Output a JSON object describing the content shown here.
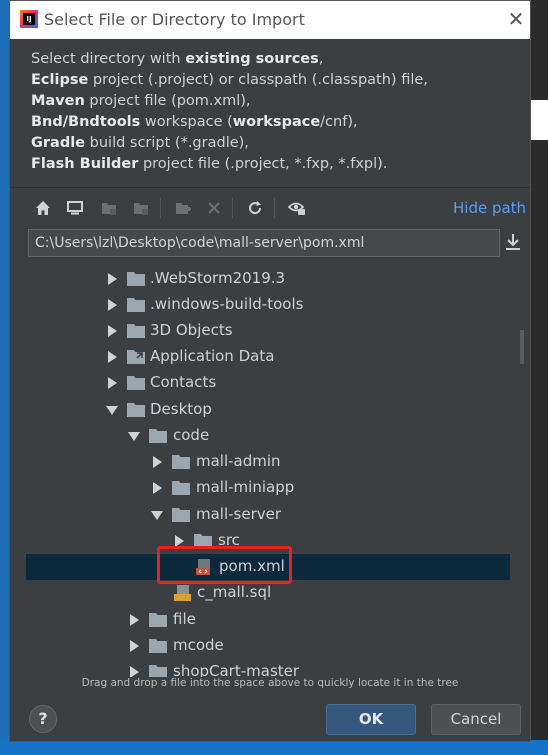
{
  "window": {
    "title": "Select File or Directory to Import",
    "close_glyph": "✕"
  },
  "description": {
    "lines": [
      {
        "pre": "Select directory with ",
        "bold": "existing sources",
        "post": ","
      },
      {
        "pre": "",
        "bold": "Eclipse",
        "post": " project (.project) or classpath (.classpath) file,"
      },
      {
        "pre": "",
        "bold": "Maven",
        "post": " project file (pom.xml),"
      },
      {
        "pre": "",
        "bold": "Bnd/Bndtools",
        "post": " workspace (",
        "bold2": "workspace",
        "post2": "/cnf),"
      },
      {
        "pre": "",
        "bold": "Gradle",
        "post": " build script (*.gradle),"
      },
      {
        "pre": "",
        "bold": "Flash Builder",
        "post": " project file (.project, *.fxp, *.fxpl)."
      }
    ]
  },
  "toolbar": {
    "icons": [
      "home-icon",
      "desktop-icon",
      "project-folder-icon",
      "module-folder-icon",
      "new-folder-icon",
      "delete-icon",
      "refresh-icon",
      "show-hidden-icon"
    ],
    "hide_path_label": "Hide path"
  },
  "path": {
    "value": "C:\\Users\\lzl\\Desktop\\code\\mall-server\\pom.xml"
  },
  "tree": {
    "items": [
      {
        "label": ".WebStorm2019.3",
        "state": "collapsed",
        "type": "folder"
      },
      {
        "label": ".windows-build-tools",
        "state": "collapsed",
        "type": "folder"
      },
      {
        "label": "3D Objects",
        "state": "collapsed",
        "type": "folder"
      },
      {
        "label": "Application Data",
        "state": "collapsed",
        "type": "link-folder"
      },
      {
        "label": "Contacts",
        "state": "collapsed",
        "type": "folder"
      },
      {
        "label": "Desktop",
        "state": "expanded",
        "type": "folder"
      },
      {
        "label": "code",
        "state": "expanded",
        "type": "folder"
      },
      {
        "label": "mall-admin",
        "state": "collapsed",
        "type": "folder"
      },
      {
        "label": "mall-miniapp",
        "state": "collapsed",
        "type": "folder"
      },
      {
        "label": "mall-server",
        "state": "expanded",
        "type": "folder"
      },
      {
        "label": "src",
        "state": "collapsed",
        "type": "folder"
      },
      {
        "label": "pom.xml",
        "state": "leaf",
        "type": "maven-file",
        "selected": true
      },
      {
        "label": "c_mall.sql",
        "state": "leaf",
        "type": "sql-file"
      },
      {
        "label": "file",
        "state": "collapsed",
        "type": "folder"
      },
      {
        "label": "mcode",
        "state": "collapsed",
        "type": "folder"
      },
      {
        "label": "shopCart-master",
        "state": "collapsed",
        "type": "folder"
      }
    ]
  },
  "hint": "Drag and drop a file into the space above to quickly locate it in the tree",
  "buttons": {
    "help": "?",
    "ok": "OK",
    "cancel": "Cancel"
  },
  "colors": {
    "accent_link": "#589df6",
    "selection": "#0d293e",
    "highlight_box": "#e8231f"
  }
}
